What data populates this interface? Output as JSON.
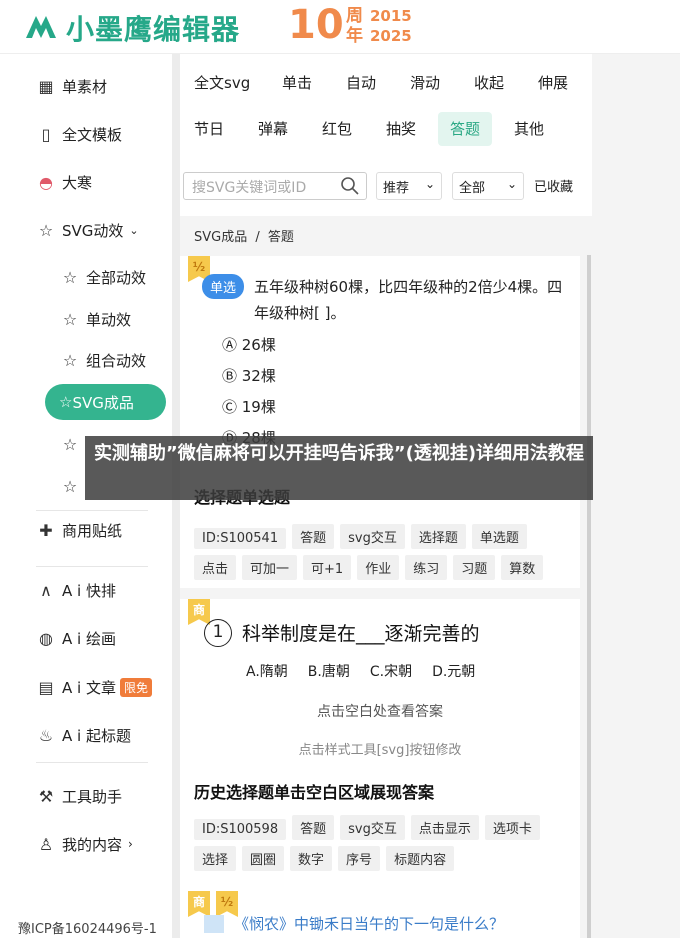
{
  "brand": {
    "name": "小墨鹰编辑器",
    "anniv_num": "10",
    "anniv_zhou": "周",
    "anniv_nian": "年",
    "anniv_y1": "2015",
    "anniv_y2": "2025"
  },
  "sidebar": {
    "items": [
      {
        "label": "单素材",
        "icon": "grid-icon"
      },
      {
        "label": "全文模板",
        "icon": "template-icon"
      },
      {
        "label": "大寒",
        "icon": "bowl-icon"
      },
      {
        "label": "SVG动效",
        "icon": "star-icon"
      },
      {
        "label": "全部动效",
        "icon": "star-icon"
      },
      {
        "label": "单动效",
        "icon": "star-icon"
      },
      {
        "label": "组合动效",
        "icon": "star-icon"
      },
      {
        "label": "SVG成品",
        "icon": "star-icon"
      },
      {
        "label": "商用贴纸",
        "icon": "puzzle-icon"
      },
      {
        "label": "A i 快排",
        "icon": "ai-icon"
      },
      {
        "label": "A i 绘画",
        "icon": "palette-icon"
      },
      {
        "label": "A i 文章",
        "icon": "doc-icon",
        "badge": "限免"
      },
      {
        "label": "A i 起标题",
        "icon": "flame-icon"
      },
      {
        "label": "工具助手",
        "icon": "tools-icon"
      },
      {
        "label": "我的内容",
        "icon": "user-icon"
      }
    ],
    "icp": "豫ICP备16024496号-1"
  },
  "categories": [
    "全文svg",
    "单击",
    "自动",
    "滑动",
    "收起",
    "伸展",
    "节日",
    "弹幕",
    "红包",
    "抽奖",
    "答题",
    "其他"
  ],
  "search": {
    "placeholder": "搜SVG关键词或ID"
  },
  "filters": {
    "sort": "推荐",
    "scope": "全部",
    "fav": "已收藏"
  },
  "breadcrumb": {
    "root": "SVG成品",
    "sep": "/",
    "current": "答题"
  },
  "card1": {
    "corner": "½",
    "pill": "单选",
    "question": "五年级种树60棵，比四年级种的2倍少4棵。四年级种树[     ]。",
    "options": [
      "Ⓐ 26棵",
      "Ⓑ 32棵",
      "Ⓒ 19棵",
      "Ⓓ 28棵"
    ],
    "title": "选择题单选题",
    "tags": [
      "ID:S100541",
      "答题",
      "svg交互",
      "选择题",
      "单选题",
      "点击",
      "可加一",
      "可+1",
      "作业",
      "练习",
      "习题",
      "算数"
    ]
  },
  "card2": {
    "corner": "商",
    "num": "1",
    "question": "科举制度是在___逐渐完善的",
    "options": [
      "A.隋朝",
      "B.唐朝",
      "C.宋朝",
      "D.元朝"
    ],
    "hint": "点击空白处查看答案",
    "hint2": "点击样式工具[svg]按钮修改",
    "title": "历史选择题单击空白区域展现答案",
    "tags": [
      "ID:S100598",
      "答题",
      "svg交互",
      "点击显示",
      "选项卡",
      "选择",
      "圆圈",
      "数字",
      "序号",
      "标题内容"
    ]
  },
  "card3": {
    "corner1": "商",
    "corner2": "½",
    "question": "《悯农》中锄禾日当午的下一句是什么？"
  },
  "overlay": {
    "text": "实测辅助”微信麻将可以开挂吗告诉我”(透视挂)详细用法教程"
  }
}
